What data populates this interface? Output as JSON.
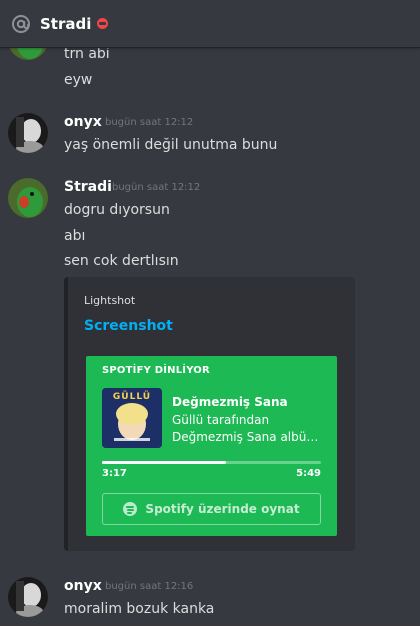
{
  "header": {
    "channel": "Stradi",
    "at_icon": "at-icon",
    "status_icon": "dnd-icon"
  },
  "messages": [
    {
      "lines": [
        "trn abi",
        "eyw"
      ]
    },
    {
      "author": "onyx",
      "time": "bugün saat 12:12",
      "lines": [
        "yaş önemli değil unutma bunu"
      ]
    },
    {
      "author": "Stradi",
      "time": "bugün saat 12:12",
      "lines": [
        "dogru dıyorsun",
        "abı",
        "sen cok dertlısın"
      ]
    },
    {
      "author": "onyx",
      "time": "bugün saat 12:16",
      "lines": [
        "moralim bozuk kanka"
      ]
    }
  ],
  "embed": {
    "provider": "Lightshot",
    "title": "Screenshot",
    "spotify": {
      "header": "SPOTİFY DİNLİYOR",
      "album_art_text": "GÜLLÜ",
      "track": "Değmezmiş Sana",
      "artist": "Güllü tarafından",
      "album": "Değmezmiş Sana albü…",
      "elapsed": "3:17",
      "duration": "5:49",
      "progress": 0.564,
      "play_button": "Spotify üzerinde oynat",
      "accent": "#1db954"
    }
  },
  "colors": {
    "background": "#36393f",
    "link": "#00b0f4",
    "dnd": "#f04747"
  }
}
